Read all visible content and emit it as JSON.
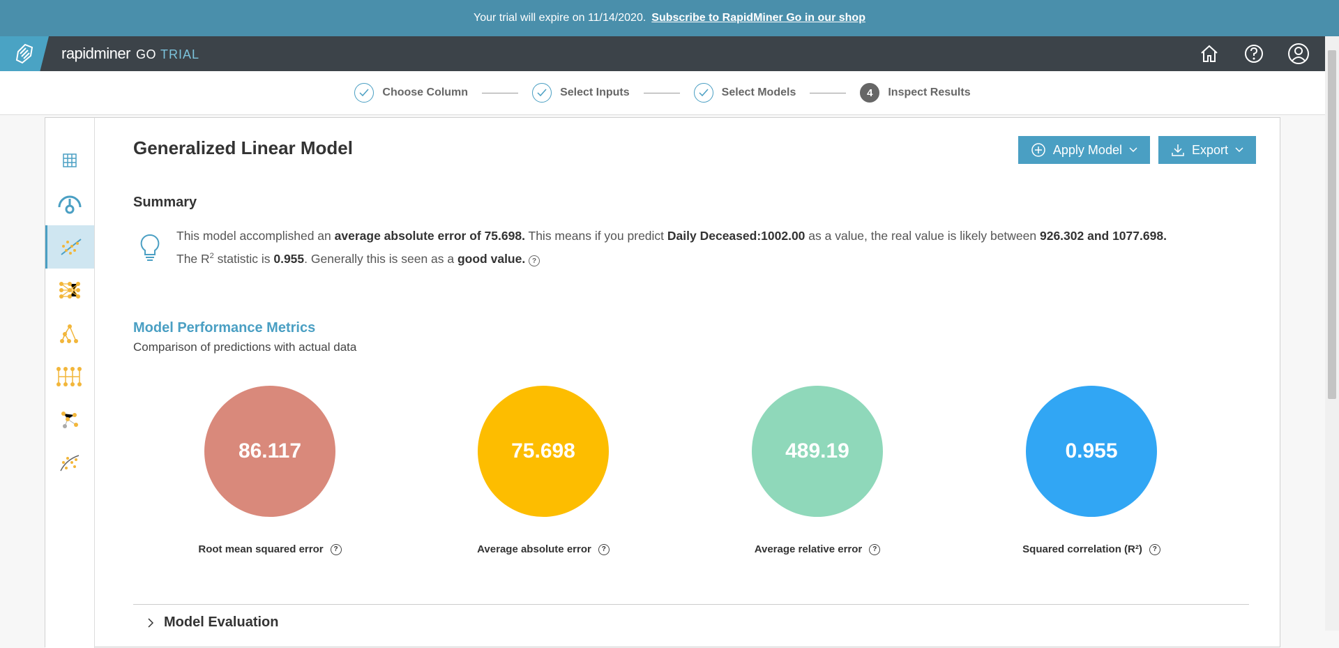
{
  "trial_banner": {
    "text": "Your trial will expire on 11/14/2020.",
    "link": "Subscribe to RapidMiner Go in our shop"
  },
  "brand": {
    "name": "rapidminer",
    "product": "GO",
    "edition": "TRIAL"
  },
  "topnav": {
    "icons": [
      "home-icon",
      "help-icon",
      "user-icon"
    ]
  },
  "stepper": {
    "steps": [
      {
        "label": "Choose Column",
        "state": "done"
      },
      {
        "label": "Select Inputs",
        "state": "done"
      },
      {
        "label": "Select Models",
        "state": "done"
      },
      {
        "label": "Inspect Results",
        "state": "active",
        "number": "4"
      }
    ]
  },
  "sidebar": {
    "items": [
      "table-icon",
      "gauge-icon",
      "linear-model-icon",
      "neural-net-icon",
      "decision-tree-icon",
      "deep-learning-icon",
      "cluster-icon",
      "scatter-trend-icon"
    ],
    "active_index": 2
  },
  "model": {
    "title": "Generalized Linear Model",
    "apply_label": "Apply Model",
    "export_label": "Export"
  },
  "summary": {
    "title": "Summary",
    "t1": "This model accomplished an ",
    "b1": "average absolute error of 75.698.",
    "t2": " This means if you predict ",
    "b2": "Daily Deceased:1002.00",
    "t3": " as a value, the real value is likely between ",
    "b3": "926.302 and 1077.698.",
    "t4": "The R",
    "sup": "2",
    "t5": " statistic is ",
    "b4": "0.955",
    "t6": ". Generally this is seen as a ",
    "b5": "good value."
  },
  "metrics": {
    "title": "Model Performance Metrics",
    "subtitle": "Comparison of predictions with actual data",
    "items": [
      {
        "value": "86.117",
        "label": "Root mean squared error",
        "color": "#d9897b"
      },
      {
        "value": "75.698",
        "label": "Average absolute error",
        "color": "#fdbd00"
      },
      {
        "value": "489.19",
        "label": "Average relative error",
        "color": "#8fd8ba"
      },
      {
        "value": "0.955",
        "label": "Squared correlation (R²)",
        "color": "#31a6f4"
      }
    ]
  },
  "evaluation": {
    "label": "Model Evaluation"
  },
  "colors": {
    "accent": "#4a9fc3",
    "topbar": "#3c4349",
    "banner": "#4a8fab"
  }
}
